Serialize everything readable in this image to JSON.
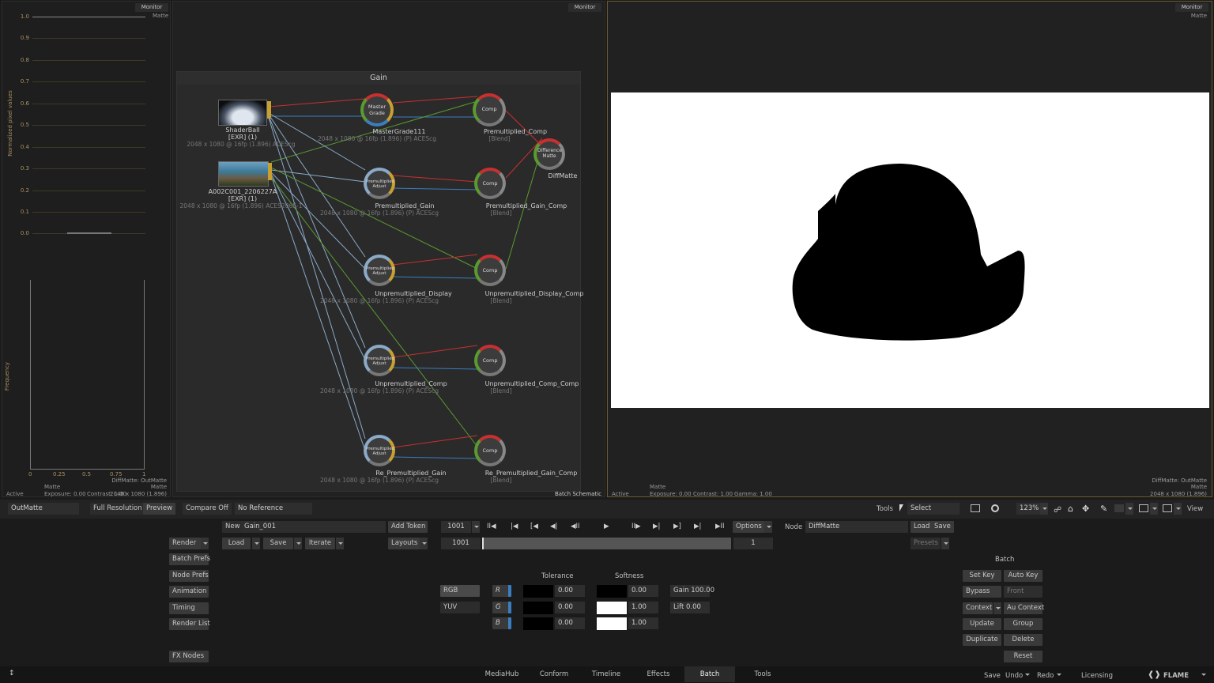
{
  "monitor_label": "Monitor",
  "matte_label": "Matte",
  "histogram": {
    "y_ticks": [
      "1.0",
      "0.9",
      "0.8",
      "0.7",
      "0.6",
      "0.5",
      "0.4",
      "0.3",
      "0.2",
      "0.1",
      "0.0"
    ],
    "y_axis_label": "Normalized pixel values",
    "freq_label": "Frequency",
    "x_ticks": [
      "0",
      "0.25",
      "0.5",
      "0.75",
      "1"
    ],
    "node_info": "DiffMatte: OutMatte",
    "matte": "Matte",
    "resolution": "2048 x 1080 (1.896)",
    "status_active": "Active",
    "exposure": "Exposure: 0.00",
    "contrast": "Contrast: 1.00"
  },
  "schematic": {
    "group_title": "Gain",
    "footer": "Batch Schematic",
    "nodes": {
      "shaderball": {
        "name": "ShaderBall",
        "type": "[EXR] (1)",
        "info": "2048 x 1080 @ 16fp (1.896) ACEScg"
      },
      "a002": {
        "name": "A002C001_2206227A",
        "type": "[EXR] (1)",
        "info": "2048 x 1080 @ 16fp (1.896) ACES2065-1"
      },
      "mastergrade": {
        "name": "MasterGrade111",
        "info": "2048 x 1080 @ 16fp (1.896) (P) ACEScg",
        "icon": "Master Grade"
      },
      "premult_comp": {
        "name": "Premultiplied_Comp",
        "sub": "[Blend]"
      },
      "diffmatte": {
        "name": "DiffMatte",
        "icon": "Difference Matte"
      },
      "premult_gain": {
        "name": "Premultiplied_Gain",
        "info": "2048 x 1080 @ 16fp (1.896) (P) ACEScg"
      },
      "premult_gain_comp": {
        "name": "Premultiplied_Gain_Comp",
        "sub": "[Blend]"
      },
      "unpremult_display": {
        "name": "Unpremultiplied_Display",
        "info": "2048 x 1080 @ 16fp (1.896) (P) ACEScg"
      },
      "unpremult_display_comp": {
        "name": "Unpremultiplied_Display_Comp",
        "sub": "[Blend]"
      },
      "unpremult_comp": {
        "name": "Unpremultiplied_Comp",
        "info": "2048 x 1080 @ 16fp (1.896) (P) ACEScg"
      },
      "unpremult_comp_comp": {
        "name": "Unpremultiplied_Comp_Comp",
        "sub": "[Blend]"
      },
      "re_premult_gain": {
        "name": "Re_Premultiplied_Gain",
        "info": "2048 x 1080 @ 16fp (1.896) (P) ACEScg"
      },
      "re_premult_gain_comp": {
        "name": "Re_Premultiplied_Gain_Comp",
        "sub": "[Blend]"
      },
      "adjust_icon": "Premultiplied Adjust",
      "comp_icon": "Comp"
    }
  },
  "viewer": {
    "status_active": "Active",
    "matte": "Matte",
    "exposure": "Exposure: 0.00",
    "contrast": "Contrast: 1.00",
    "gamma": "Gamma: 1.00",
    "node_info": "DiffMatte: OutMatte",
    "matte_right": "Matte",
    "resolution": "2048 x 1080 (1.896)"
  },
  "viewbar": {
    "output": "OutMatte",
    "full_res": "Full Resolution",
    "preview": "Preview",
    "compare": "Compare Off",
    "reference": "No Reference",
    "tools": "Tools",
    "select": "Select",
    "zoom": "123%",
    "view": "View"
  },
  "batch": {
    "new": "New",
    "name": "Gain_001",
    "add_token": "Add Token",
    "render": "Render",
    "load": "Load",
    "save": "Save",
    "iterate": "Iterate",
    "layouts": "Layouts",
    "batch_prefs": "Batch Prefs",
    "node_prefs": "Node Prefs",
    "animation": "Animation",
    "timing": "Timing",
    "render_list": "Render List",
    "fx_nodes": "FX Nodes",
    "frame": "1001",
    "frame_start": "1001",
    "frame_count": "1",
    "options": "Options"
  },
  "node_panel": {
    "node_label": "Node",
    "node_name": "DiffMatte",
    "load": "Load",
    "save": "Save",
    "presets": "Presets",
    "tolerance": "Tolerance",
    "softness": "Softness",
    "rgb": "RGB",
    "yuv": "YUV",
    "channels": [
      "R",
      "G",
      "B"
    ],
    "tolerance_values": [
      "0.00",
      "0.00",
      "0.00"
    ],
    "softness_values": [
      "0.00",
      "1.00",
      "1.00"
    ],
    "gain": "Gain 100.00",
    "lift": "Lift 0.00"
  },
  "right_panel": {
    "title": "Batch",
    "set_key": "Set Key",
    "auto_key": "Auto Key",
    "bypass": "Bypass",
    "front": "Front",
    "context": "Context",
    "au_context": "Au Context",
    "update": "Update",
    "group": "Group",
    "duplicate": "Duplicate",
    "delete": "Delete",
    "reset": "Reset"
  },
  "bottom_tabs": [
    "MediaHub",
    "Conform",
    "Timeline",
    "Effects",
    "Batch",
    "Tools"
  ],
  "bottom_right": {
    "save": "Save",
    "undo": "Undo",
    "redo": "Redo",
    "licensing": "Licensing",
    "brand": "FLAME"
  },
  "colors": {
    "accent": "#c8a030",
    "link_red": "#c83030",
    "link_blue": "#3a7ec0",
    "link_green": "#5a9a30",
    "link_light": "#8aaac8"
  }
}
